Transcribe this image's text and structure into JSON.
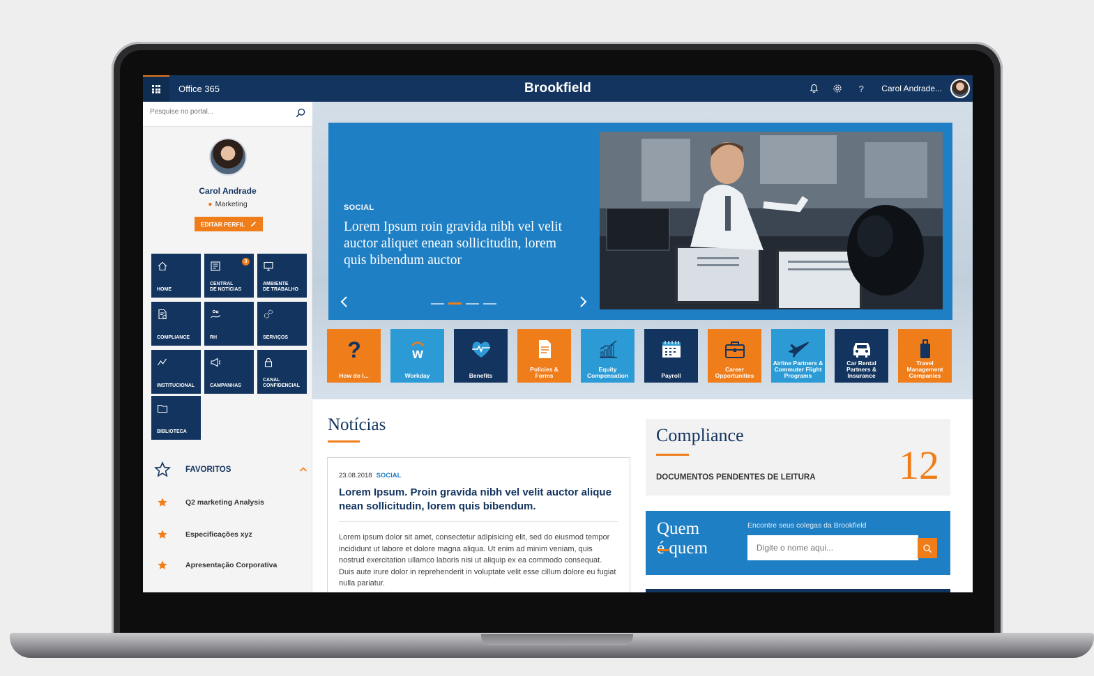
{
  "topbar": {
    "app_name": "Office 365",
    "brand": "Brookfield",
    "user_name": "Carol Andrade...",
    "help_glyph": "?",
    "icons": [
      "waffle-icon",
      "bell-icon",
      "gear-icon",
      "help-icon"
    ]
  },
  "sidebar": {
    "search_placeholder": "Pesquise no portal...",
    "profile": {
      "name": "Carol Andrade",
      "department": "Marketing",
      "edit_label": "EDITAR PERFIL"
    },
    "tiles": [
      {
        "label": "HOME",
        "icon": "home-icon"
      },
      {
        "label": "CENTRAL\nDE NOTÍCIAS",
        "icon": "news-icon",
        "badge": "3"
      },
      {
        "label": "AMBIENTE\nDE TRABALHO",
        "icon": "desktop-icon"
      },
      {
        "label": "COMPLIANCE",
        "icon": "document-check-icon"
      },
      {
        "label": "RH",
        "icon": "hand-people-icon"
      },
      {
        "label": "SERVIÇOS",
        "icon": "gears-icon"
      },
      {
        "label": "INSTITUCIONAL",
        "icon": "chart-line-icon"
      },
      {
        "label": "CAMPANHAS",
        "icon": "megaphone-icon"
      },
      {
        "label": "CANAL\nCONFIDENCIAL",
        "icon": "lock-icon"
      },
      {
        "label": "BIBLIOTECA",
        "icon": "folder-icon"
      }
    ],
    "favorites": {
      "title": "FAVORITOS",
      "items": [
        "Q2 marketing Analysis",
        "Especificações xyz",
        "Apresentação Corporativa"
      ]
    }
  },
  "hero": {
    "category": "SOCIAL",
    "title": "Lorem Ipsum roin gravida nibh vel velit auctor aliquet enean sollicitudin, lorem quis bibendum auctor",
    "slides": 4,
    "active_slide": 2
  },
  "apps": [
    {
      "label": "How do I...",
      "color": "orange",
      "icon": "question-icon"
    },
    {
      "label": "Workday",
      "color": "cyan",
      "icon": "workday-icon"
    },
    {
      "label": "Benefits",
      "color": "navy",
      "icon": "heart-pulse-icon"
    },
    {
      "label": "Policies &\nForms",
      "color": "orange",
      "icon": "document-icon"
    },
    {
      "label": "Equity\nCompensation",
      "color": "cyan",
      "icon": "bar-growth-icon"
    },
    {
      "label": "Payroll",
      "color": "navy",
      "icon": "calendar-icon"
    },
    {
      "label": "Career\nOpportunities",
      "color": "orange",
      "icon": "briefcase-icon"
    },
    {
      "label": "Airline Partners &\nCommuter Flight\nPrograms",
      "color": "cyan",
      "icon": "airplane-icon"
    },
    {
      "label": "Car Rental\nPartners &\nInsurance",
      "color": "navy",
      "icon": "car-icon"
    },
    {
      "label": "Travel\nManagement\nCompanies",
      "color": "orange",
      "icon": "luggage-icon"
    }
  ],
  "news": {
    "section_title": "Notícias",
    "date": "23.08.2018",
    "category": "SOCIAL",
    "headline": "Lorem Ipsum. Proin gravida nibh vel velit auctor alique nean sollicitudin, lorem quis bibendum.",
    "body": "Lorem ipsum dolor sit amet, consectetur adipisicing elit, sed do eiusmod tempor incididunt ut labore et dolore magna aliqua. Ut enim ad minim veniam, quis nostrud exercitation ullamco laboris nisi ut aliquip ex ea commodo consequat. Duis aute irure dolor in reprehenderit in voluptate velit esse cillum dolore eu fugiat nulla pariatur."
  },
  "compliance": {
    "title": "Compliance",
    "subtitle": "DOCUMENTOS PENDENTES DE LEITURA",
    "count": "12"
  },
  "quem": {
    "title_line1": "Quem",
    "title_line2": "é quem",
    "label": "Encontre seus colegas da Brookfield",
    "placeholder": "Digite o nome aqui..."
  },
  "colors": {
    "navy": "#13345e",
    "blue": "#1f7fc4",
    "cyan": "#2c9ad4",
    "orange": "#ef7d1a"
  }
}
